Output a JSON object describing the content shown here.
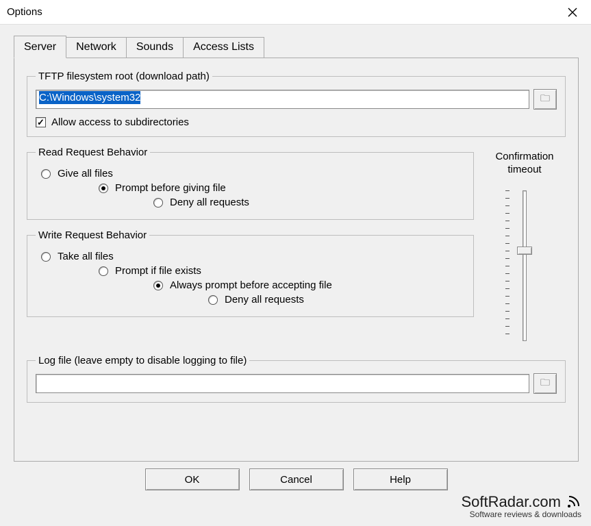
{
  "window": {
    "title": "Options"
  },
  "tabs": {
    "items": [
      "Server",
      "Network",
      "Sounds",
      "Access Lists"
    ],
    "active": "Server"
  },
  "filesystem": {
    "legend": "TFTP filesystem root (download path)",
    "path": "C:\\Windows\\system32",
    "allow_subdirs_label": "Allow access to subdirectories",
    "allow_subdirs_checked": true
  },
  "read_behavior": {
    "legend": "Read Request Behavior",
    "options": [
      {
        "label": "Give all files",
        "checked": false
      },
      {
        "label": "Prompt before giving file",
        "checked": true
      },
      {
        "label": "Deny all requests",
        "checked": false
      }
    ]
  },
  "write_behavior": {
    "legend": "Write Request Behavior",
    "options": [
      {
        "label": "Take all files",
        "checked": false
      },
      {
        "label": "Prompt if file exists",
        "checked": false
      },
      {
        "label": "Always prompt before accepting file",
        "checked": true
      },
      {
        "label": "Deny all requests",
        "checked": false
      }
    ]
  },
  "confirmation": {
    "label_line1": "Confirmation",
    "label_line2": "timeout"
  },
  "log": {
    "legend": "Log file (leave empty to disable logging to file)",
    "value": ""
  },
  "buttons": {
    "ok": "OK",
    "cancel": "Cancel",
    "help": "Help"
  },
  "watermark": {
    "main": "SoftRadar.com",
    "sub": "Software reviews & downloads"
  }
}
